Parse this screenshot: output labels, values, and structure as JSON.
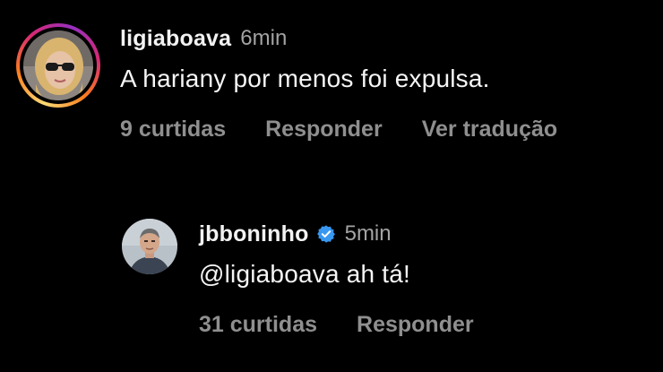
{
  "comments": [
    {
      "username": "ligiaboava",
      "time": "6min",
      "text": "A hariany por menos foi expulsa.",
      "likes": "9 curtidas",
      "reply_label": "Responder",
      "translate_label": "Ver tradução",
      "avatar_icon": "user-photo-icon",
      "has_story_ring": true
    },
    {
      "username": "jbboninho",
      "verified": true,
      "verified_icon": "verified-badge-icon",
      "time": "5min",
      "text": "@ligiaboava ah tá!",
      "likes": "31 curtidas",
      "reply_label": "Responder",
      "avatar_icon": "user-photo-icon",
      "has_story_ring": false
    }
  ],
  "colors": {
    "background": "#000000",
    "text": "#f5f5f5",
    "muted": "#a3a3a3",
    "action": "#8f8f8f",
    "verified_blue": "#3897f0"
  }
}
